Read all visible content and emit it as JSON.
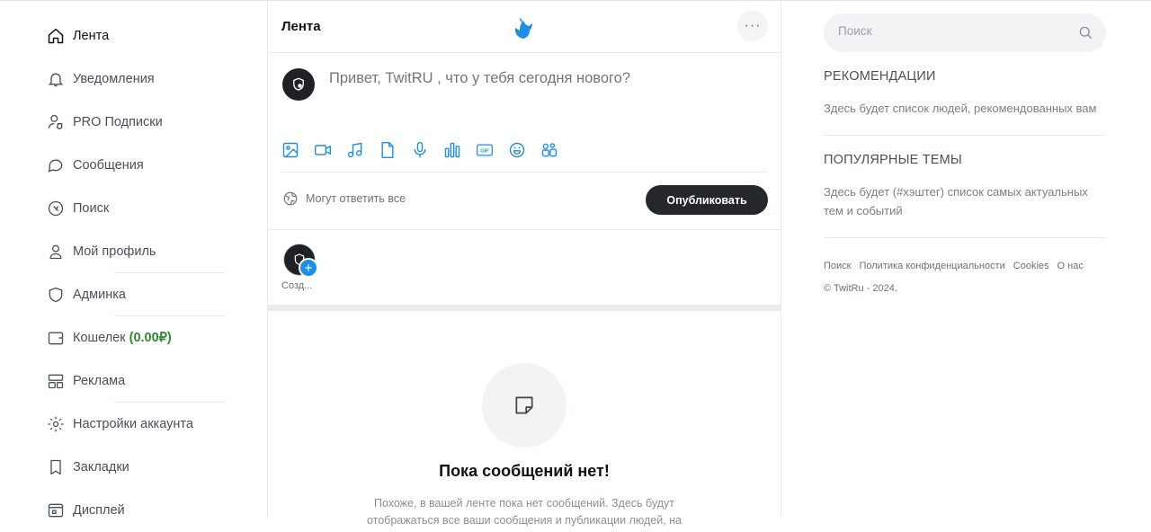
{
  "sidebar": {
    "items": [
      {
        "label": "Лента",
        "icon": "home-icon"
      },
      {
        "label": "Уведомления",
        "icon": "bell-icon"
      },
      {
        "label": "PRO Подписки",
        "icon": "pro-subscriptions-icon"
      },
      {
        "label": "Сообщения",
        "icon": "chat-icon"
      },
      {
        "label": "Поиск",
        "icon": "search-compass-icon"
      },
      {
        "label": "Мой профиль",
        "icon": "user-icon"
      },
      {
        "label": "Админка",
        "icon": "shield-icon"
      },
      {
        "label": "Кошелек",
        "balance": "(0.00₽)",
        "icon": "wallet-icon"
      },
      {
        "label": "Реклама",
        "icon": "ads-layout-icon"
      },
      {
        "label": "Настройки аккаунта",
        "icon": "settings-gear-icon"
      },
      {
        "label": "Закладки",
        "icon": "bookmark-icon"
      },
      {
        "label": "Дисплей",
        "icon": "display-icon"
      }
    ]
  },
  "feed": {
    "title": "Лента",
    "more_label": "···",
    "composer_placeholder": "Привет, TwitRU , что у тебя сегодня нового?",
    "tools": [
      "image-icon",
      "video-icon",
      "music-icon",
      "document-icon",
      "microphone-icon",
      "poll-icon",
      "gif-icon",
      "emoji-icon",
      "people-icon"
    ],
    "reply_permission": "Могут ответить все",
    "publish_label": "Опубликовать",
    "story_label": "Созд...",
    "empty_title": "Пока сообщений нет!",
    "empty_text": "Похоже, в вашей ленте пока нет сообщений. Здесь будут отображаться все ваши сообщения и публикации людей, на"
  },
  "right": {
    "search_placeholder": "Поиск",
    "recommendations_title": "РЕКОМЕНДАЦИИ",
    "recommendations_text": "Здесь будет список людей, рекомендованных вам",
    "topics_title": "ПОПУЛЯРНЫЕ ТЕМЫ",
    "topics_text": "Здесь будет (#хэштег) список самых актуальных тем и событий",
    "footer_links": [
      "Поиск",
      "Политика конфиденциальности",
      "Cookies",
      "О нас"
    ],
    "copyright": "© TwitRu - 2024."
  },
  "colors": {
    "accent": "#1d8fe6",
    "balance": "#2e8b2e",
    "button_dark": "#24272b"
  }
}
